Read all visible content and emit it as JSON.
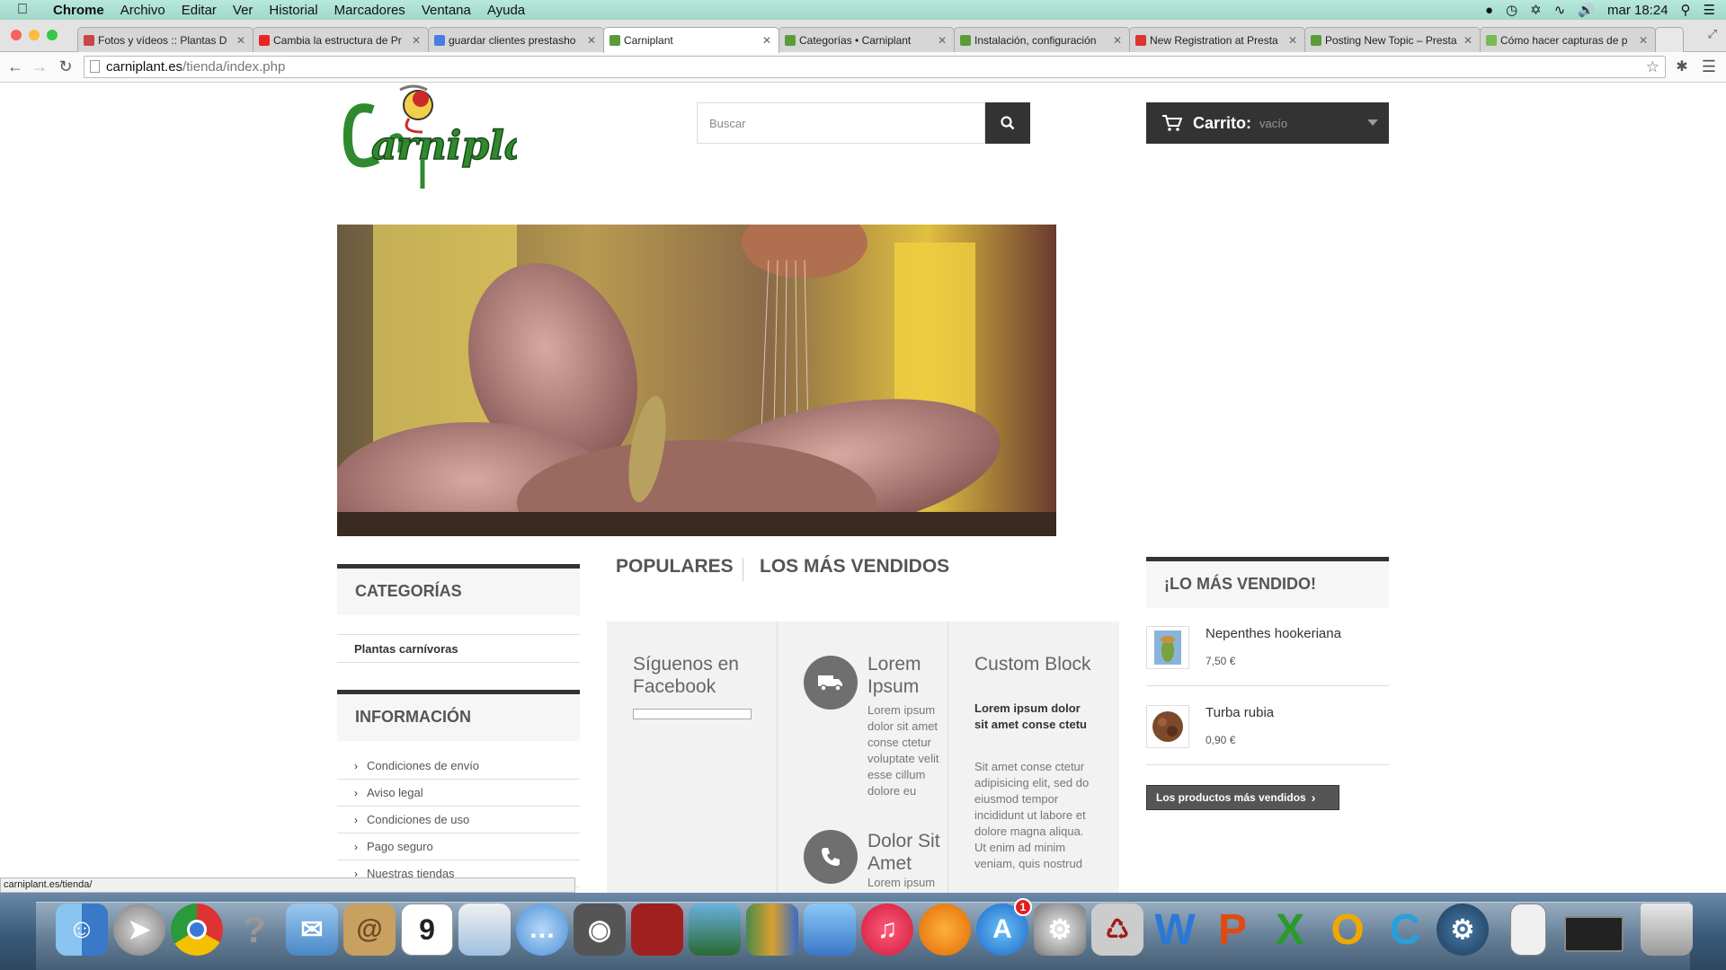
{
  "menubar": {
    "app": "Chrome",
    "menus": [
      "Archivo",
      "Editar",
      "Ver",
      "Historial",
      "Marcadores",
      "Ventana",
      "Ayuda"
    ],
    "clock": "mar 18:24"
  },
  "tabs": [
    {
      "title": "Fotos y vídeos :: Plantas D",
      "favicon": "site-icon",
      "color": "#c44"
    },
    {
      "title": "Cambia la estructura de Pr",
      "favicon": "youtube-icon",
      "color": "#e22"
    },
    {
      "title": "guardar clientes prestasho",
      "favicon": "google-icon",
      "color": "#4a7de4"
    },
    {
      "title": "Carniplant",
      "favicon": "leaf-icon",
      "color": "#5a9c3a"
    },
    {
      "title": "Categorías • Carniplant",
      "favicon": "leaf-icon",
      "color": "#5a9c3a"
    },
    {
      "title": "Instalación, configuración",
      "favicon": "leaf-icon",
      "color": "#5a9c3a"
    },
    {
      "title": "New Registration at Presta",
      "favicon": "gmail-icon",
      "color": "#d33"
    },
    {
      "title": "Posting New Topic – Presta",
      "favicon": "leaf-icon",
      "color": "#5a9c3a"
    },
    {
      "title": "Cómo hacer capturas de p",
      "favicon": "site-icon",
      "color": "#7b5"
    }
  ],
  "address": {
    "host": "carniplant.es",
    "path": "/tienda/index.php"
  },
  "header": {
    "search_placeholder": "Buscar",
    "cart_label": "Carrito:",
    "cart_status": "vacío"
  },
  "left": {
    "categories_title": "CATEGORÍAS",
    "categories": [
      "Plantas carnívoras"
    ],
    "info_title": "INFORMACIÓN",
    "info_links": [
      "Condiciones de envío",
      "Aviso legal",
      "Condiciones de uso",
      "Pago seguro",
      "Nuestras tiendas"
    ]
  },
  "center": {
    "tabs": [
      "POPULARES",
      "LOS MÁS VENDIDOS"
    ],
    "facebook_title": "Síguenos en Facebook",
    "block1_title": "Lorem Ipsum",
    "block1_text": "Lorem ipsum dolor sit amet conse ctetur voluptate velit esse cillum dolore eu",
    "block2_title": "Dolor Sit Amet",
    "block2_text": "Lorem ipsum",
    "custom_title": "Custom Block",
    "custom_bold": "Lorem ipsum dolor sit amet conse ctetu",
    "custom_text": "Sit amet conse ctetur adipisicing elit, sed do eiusmod tempor incididunt ut labore et dolore magna aliqua. Ut enim ad minim veniam, quis nostrud"
  },
  "right": {
    "title": "¡LO MÁS VENDIDO!",
    "products": [
      {
        "name": "Nepenthes hookeriana",
        "price": "7,50 €"
      },
      {
        "name": "Turba rubia",
        "price": "0,90 €"
      }
    ],
    "all_button": "Los productos más vendidos"
  },
  "status_url": "carniplant.es/tienda/",
  "dock": {
    "items": [
      "finder-icon",
      "launchpad-icon",
      "chrome-icon",
      "help-icon",
      "mail-icon",
      "contacts-icon",
      "calendar-icon",
      "preview-icon",
      "messages-icon",
      "facetime-icon",
      "photobooth-icon",
      "iphoto-icon",
      "numbers-icon",
      "keynote-icon",
      "itunes-icon",
      "ibooks-icon",
      "appstore-icon",
      "preferences-icon",
      "pdf-icon",
      "word-icon",
      "powerpoint-icon",
      "excel-icon",
      "outlook-icon",
      "c-icon",
      "steam-icon",
      "document-icon",
      "monitor-icon",
      "trash-icon"
    ],
    "calendar_day": "9",
    "appstore_badge": "1"
  }
}
